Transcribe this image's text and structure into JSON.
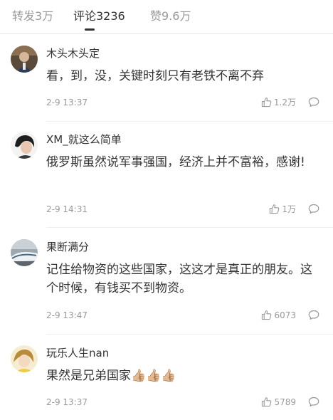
{
  "tabs": {
    "repost": "转发3万",
    "comments": "评论3236",
    "likes": "赞9.6万"
  },
  "comments": [
    {
      "username": "木头木头定",
      "text": "看，到，没，关键时刻只有老铁不离不弃",
      "time": "2-9 13:37",
      "likes": "1.2万"
    },
    {
      "username": "XM_就这么简单",
      "text": "俄罗斯虽然说军事强国，经济上并不富裕，感谢!",
      "time": "2-9 14:31",
      "likes": "1万"
    },
    {
      "username": "果断满分",
      "text": "记住给物资的这些国家，这这才是真正的朋友。这个时候，有钱买不到物资。",
      "time": "2-9 13:47",
      "likes": "6073"
    },
    {
      "username": "玩乐人生nan",
      "text": "果然是兄弟国家👍🏼👍🏼👍🏼",
      "time": "2-9 13:37",
      "likes": "5789"
    }
  ],
  "icons": {
    "like": "thumbs-up-icon",
    "reply": "comment-bubble-icon"
  },
  "colors": {
    "text": "#333333",
    "meta": "#999999",
    "divider": "#eeeeee"
  }
}
